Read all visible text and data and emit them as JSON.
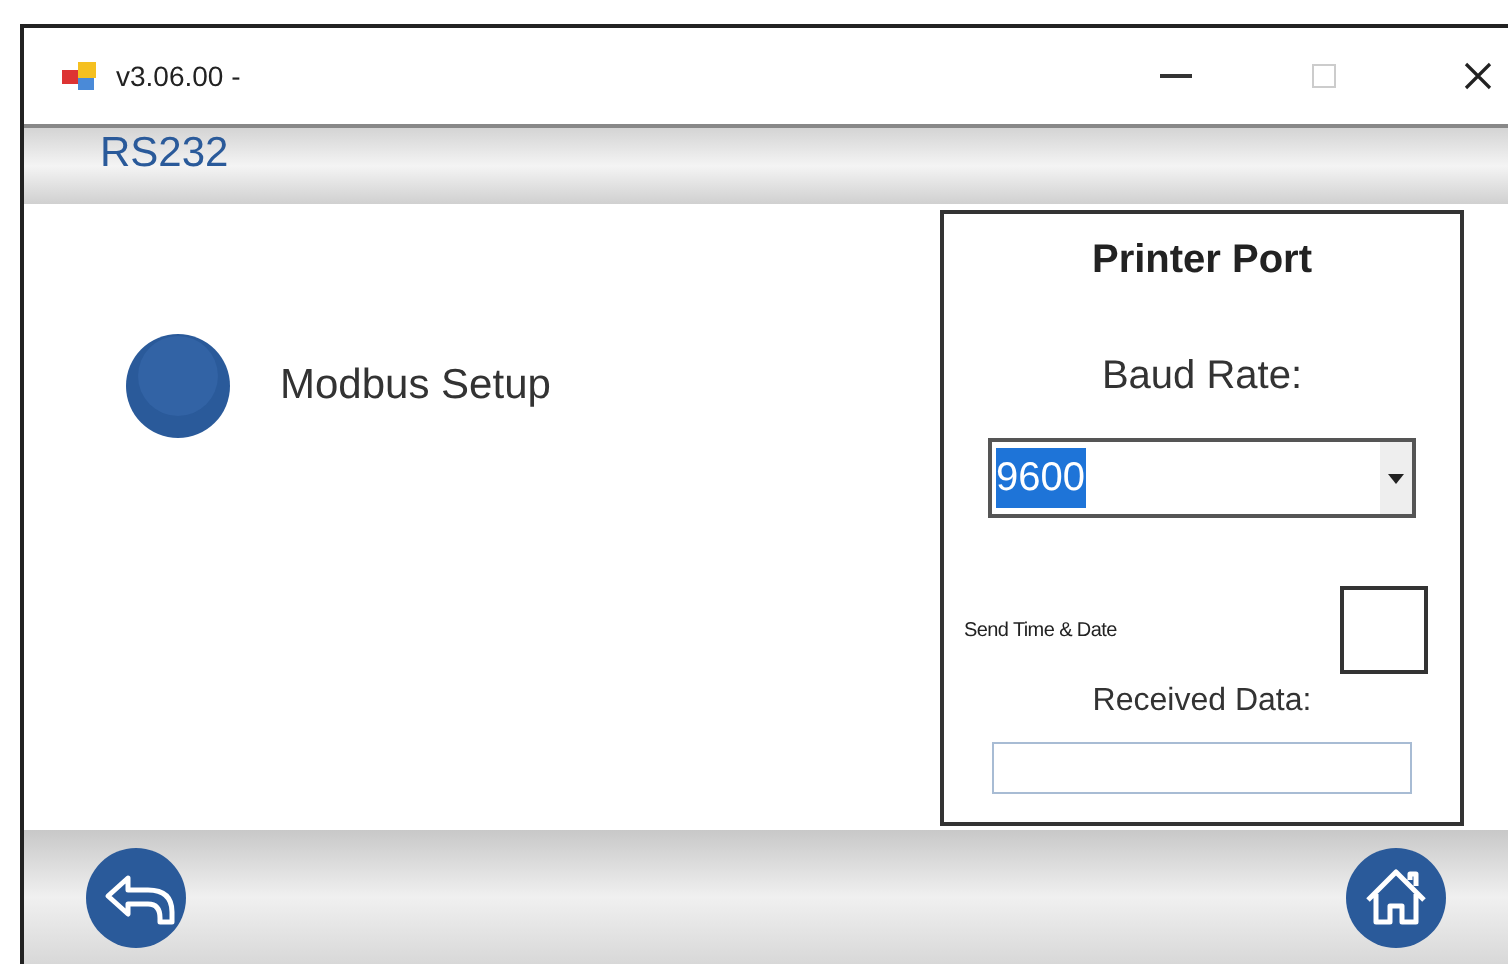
{
  "window": {
    "title": "v3.06.00 -"
  },
  "header": {
    "title": "RS232"
  },
  "menu_items": [
    {
      "label": "Modbus Setup"
    }
  ],
  "printer_port": {
    "title": "Printer Port",
    "baud_rate_label": "Baud Rate:",
    "baud_rate": {
      "value": "9600",
      "value_highlighted": true
    },
    "send_time_date": {
      "label": "Send Time & Date",
      "checked": false
    },
    "received_data_label": "Received Data:"
  }
}
